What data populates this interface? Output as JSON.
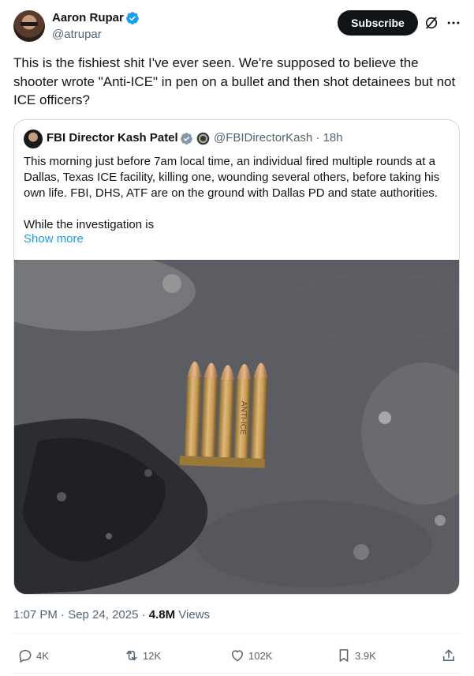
{
  "author": {
    "name": "Aaron Rupar",
    "handle": "@atrupar"
  },
  "subscribe_label": "Subscribe",
  "tweet_text": "This is the fishiest shit I've ever seen. We're supposed to believe the shooter wrote \"Anti-ICE\" in pen on a bullet and then shot detainees but not ICE officers?",
  "quote": {
    "name": "FBI Director Kash Patel",
    "handle_time": "@FBIDirectorKash · 18h",
    "text": "This morning just before 7am local time, an individual fired multiple rounds at a Dallas, Texas ICE facility, killing one, wounding several others, before taking his own life. FBI, DHS, ATF are on the ground with Dallas PD and state authorities.",
    "text2": "While the investigation is",
    "show_more": "Show more",
    "image_inscription": "ANTI-ICE"
  },
  "meta": {
    "time": "1:07 PM · Sep 24, 2025 · ",
    "views_count": "4.8M",
    "views_label": " Views"
  },
  "actions": {
    "replies": "4K",
    "reposts": "12K",
    "likes": "102K",
    "bookmarks": "3.9K"
  },
  "colors": {
    "accent": "#1d9bf0",
    "text": "#0f1419",
    "secondary": "#536471"
  }
}
